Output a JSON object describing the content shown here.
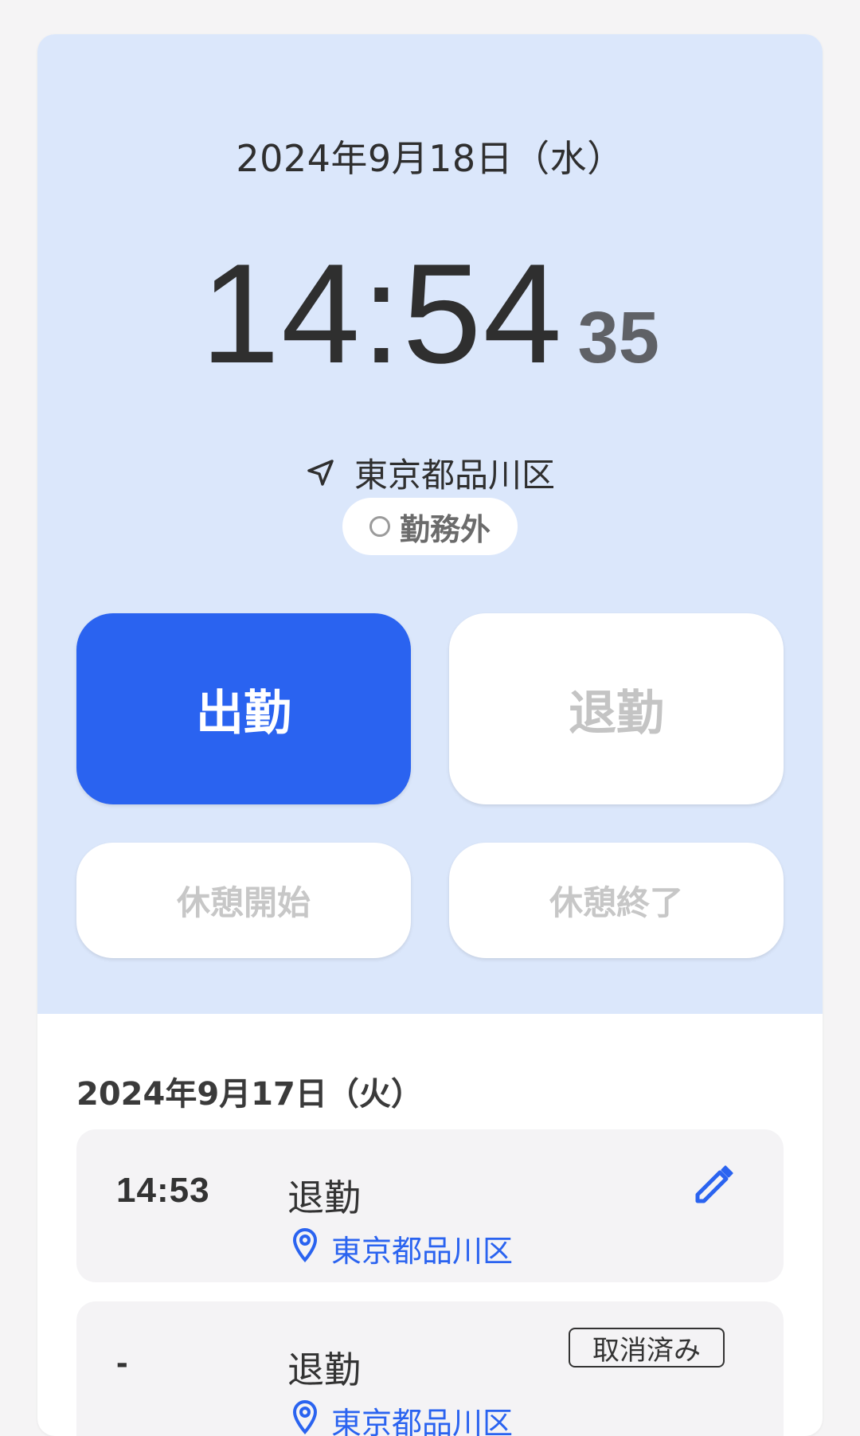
{
  "current": {
    "date": "2024年9月18日（水）",
    "time_hm": "14:54",
    "time_sec": "35",
    "location": "東京都品川区",
    "status": "勤務外"
  },
  "buttons": {
    "clock_in": "出勤",
    "clock_out": "退勤",
    "break_start": "休憩開始",
    "break_end": "休憩終了"
  },
  "history": {
    "date": "2024年9月17日（火）",
    "records": [
      {
        "time": "14:53",
        "type": "退勤",
        "location": "東京都品川区",
        "action_icon": "pencil-icon"
      },
      {
        "time": "-",
        "type": "退勤",
        "location": "東京都品川区",
        "badge": "取消済み"
      }
    ]
  },
  "colors": {
    "accent": "#2a63f0",
    "panel_bg": "#dbe7fb",
    "page_bg": "#f5f4f5",
    "record_bg": "#f4f3f5",
    "disabled_text": "#c4c4c4"
  }
}
